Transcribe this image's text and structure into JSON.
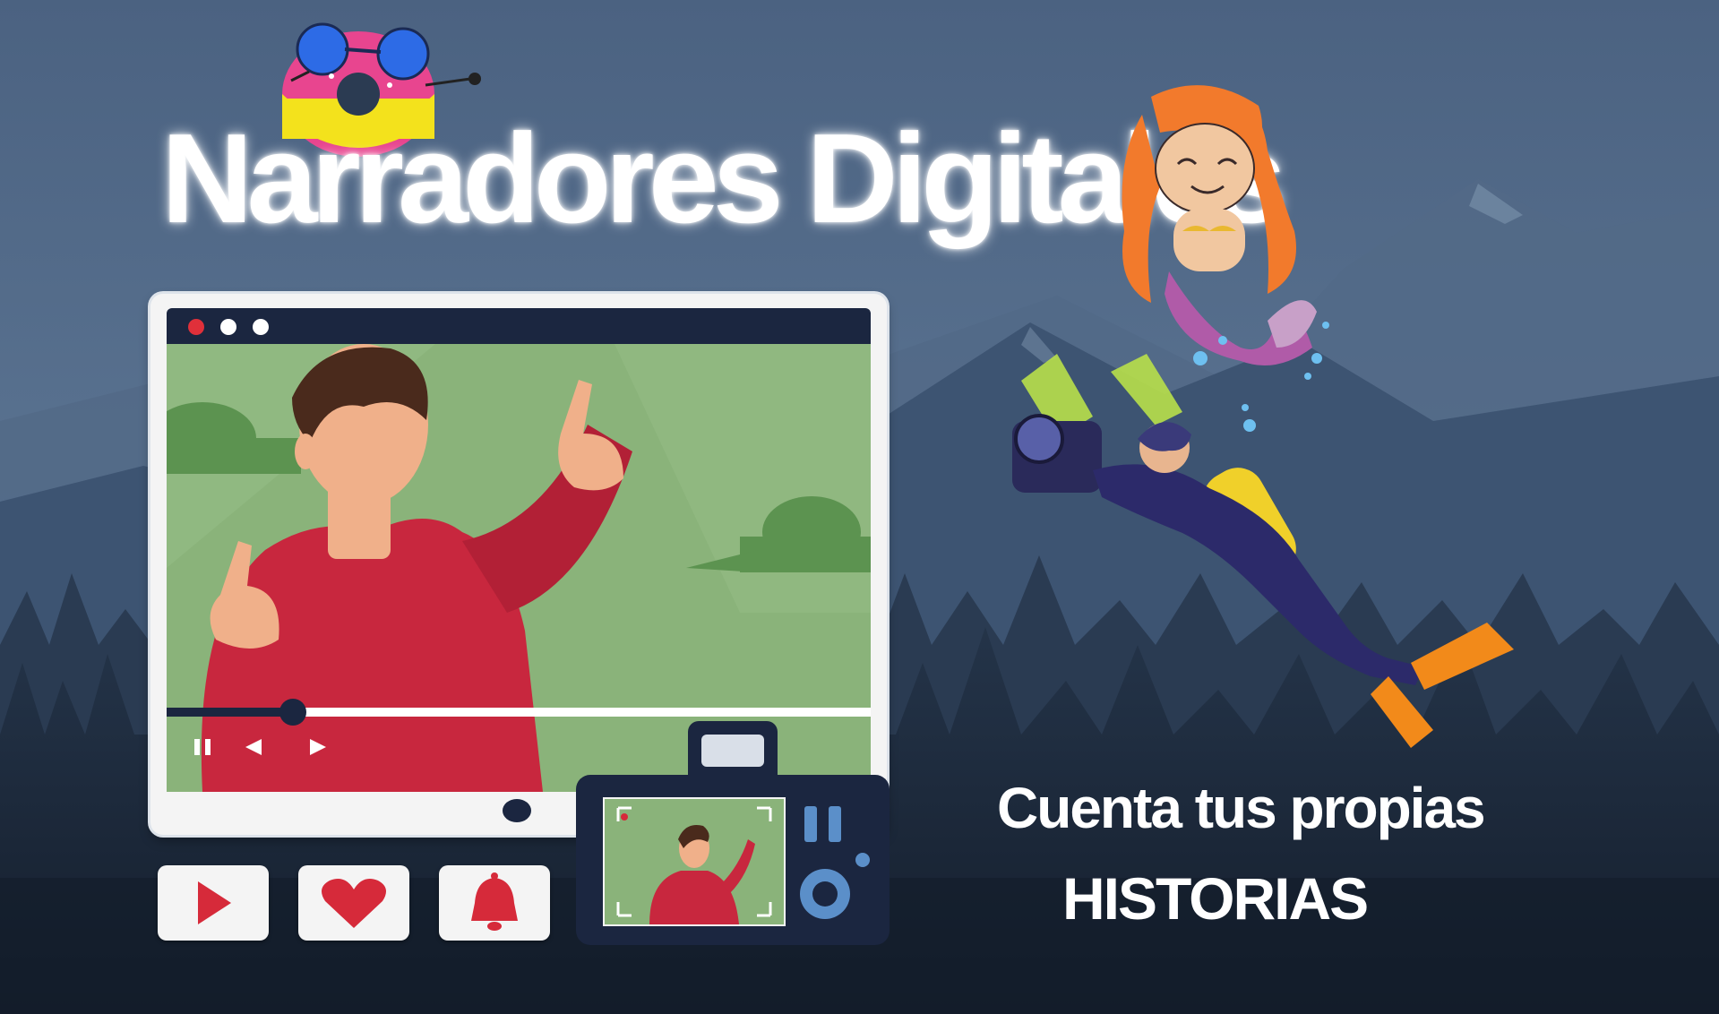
{
  "title": "Narradores Digitales",
  "tagline": {
    "line1": "Cuenta tus propias",
    "line2": "HISTORIAS"
  },
  "video_player": {
    "window_dots": [
      "#e0303a",
      "#ffffff",
      "#ffffff"
    ],
    "progress": 0.18,
    "controls": [
      "pause-icon",
      "previous-icon",
      "next-icon"
    ]
  },
  "social_buttons": [
    "play-icon",
    "heart-icon",
    "bell-icon"
  ],
  "colors": {
    "sky": "#4e6684",
    "mountains": "#3b5270",
    "forest": "#1e2c3f",
    "screen_green": "#8ab37a",
    "shirt": "#c8273e",
    "accent_red": "#d62a3a",
    "title": "#ffffff"
  }
}
